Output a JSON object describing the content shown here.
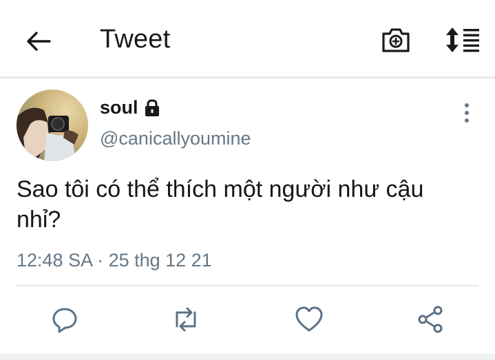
{
  "header": {
    "title": "Tweet",
    "icons": [
      "arrow-left-icon",
      "camera-plus-icon",
      "sort-list-icon"
    ]
  },
  "tweet": {
    "user": {
      "name": "soul",
      "handle": "@canicallyoumine",
      "protected": true
    },
    "text": "Sao tôi có thể thích một người như cậu nhỉ?",
    "timestamp": "12:48 SA · 25 thg 12 21",
    "actions": [
      "reply-icon",
      "retweet-icon",
      "like-icon",
      "share-icon"
    ]
  },
  "colors": {
    "text": "#14171a",
    "secondary": "#657786",
    "divider": "#e6e7e8",
    "icon": "#5b7083"
  }
}
